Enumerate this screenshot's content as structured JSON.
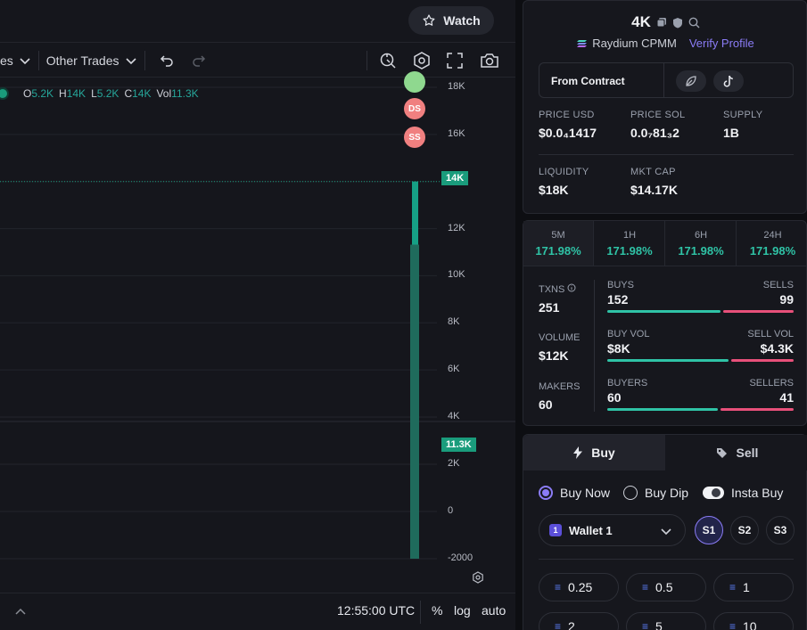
{
  "header": {
    "watch_label": "Watch"
  },
  "toolbar": {
    "dropdown1_label": "es",
    "dropdown2_label": "Other Trades"
  },
  "chart_data": {
    "type": "candlestick",
    "ohlc": {
      "o_label": "O",
      "o": "5.2K",
      "h_label": "H",
      "h": "14K",
      "l_label": "L",
      "l": "5.2K",
      "c_label": "C",
      "c": "14K",
      "vol_label": "Vol",
      "vol": "11.3K"
    },
    "markers": [
      "DS",
      "SS"
    ],
    "price_axis": [
      "18K",
      "16K",
      "14K",
      "12K",
      "10K",
      "8K",
      "6K",
      "4K",
      "2K",
      "0",
      "-2000"
    ],
    "candle": {
      "open": 5200,
      "high": 14000,
      "low": 5200,
      "close": 14000
    },
    "volume_bar": 11300,
    "last_price_tag": "14K",
    "volume_tag": "11.3K"
  },
  "footer": {
    "time": "12:55:00 UTC",
    "percent": "%",
    "log": "log",
    "auto": "auto"
  },
  "token": {
    "name": "4K",
    "platform": "Raydium CPMM",
    "verify": "Verify Profile",
    "contract_label": "From Contract",
    "stats": [
      {
        "label": "PRICE USD",
        "value": "$0.0₄1417"
      },
      {
        "label": "PRICE SOL",
        "value": "0.0₇81₃2"
      },
      {
        "label": "SUPPLY",
        "value": "1B"
      },
      {
        "label": "LIQUIDITY",
        "value": "$18K"
      },
      {
        "label": "MKT CAP",
        "value": "$14.17K"
      }
    ]
  },
  "timeframes": [
    {
      "label": "5M",
      "value": "171.98%"
    },
    {
      "label": "1H",
      "value": "171.98%"
    },
    {
      "label": "6H",
      "value": "171.98%"
    },
    {
      "label": "24H",
      "value": "171.98%"
    }
  ],
  "metrics": {
    "txns_label": "TXNS",
    "txns": "251",
    "volume_label": "VOLUME",
    "volume": "$12K",
    "makers_label": "MAKERS",
    "makers": "60",
    "buys_label": "BUYS",
    "buys": "152",
    "sells_label": "SELLS",
    "sells": "99",
    "buys_fraction": 0.606,
    "buyvol_label": "BUY VOL",
    "buyvol": "$8K",
    "sellvol_label": "SELL VOL",
    "sellvol": "$4.3K",
    "buyvol_fraction": 0.65,
    "buyers_label": "BUYERS",
    "buyers": "60",
    "sellers_label": "SELLERS",
    "sellers": "41",
    "buyers_fraction": 0.594
  },
  "trade": {
    "buy_tab": "Buy",
    "sell_tab": "Sell",
    "buy_now": "Buy Now",
    "buy_dip": "Buy Dip",
    "insta_buy": "Insta Buy",
    "wallet": "Wallet 1",
    "wallet_count": "1",
    "slots": [
      "S1",
      "S2",
      "S3"
    ],
    "amounts": [
      "0.25",
      "0.5",
      "1",
      "2",
      "5",
      "10"
    ]
  },
  "colors": {
    "accent": "#8b7cf6",
    "up": "#26a69a",
    "down": "#e8507a",
    "tag": "#1a9c7c"
  }
}
